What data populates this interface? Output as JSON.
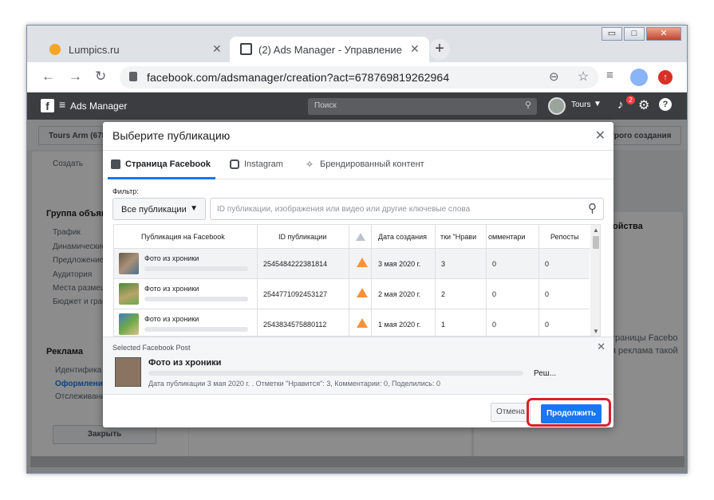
{
  "browser": {
    "tabs": [
      {
        "title": "Lumpics.ru",
        "close": "✕"
      },
      {
        "title": "(2) Ads Manager - Управление р",
        "close": "✕"
      }
    ],
    "new_tab": "+",
    "url": "facebook.com/adsmanager/creation?act=678769819262964",
    "window_buttons": [
      "▭",
      "□",
      "✕"
    ]
  },
  "fb": {
    "app_name": "Ads Manager",
    "search_placeholder": "Поиск",
    "account_name": "Tours",
    "notification_count": "2",
    "page_behind": {
      "account_button": "Tours Arm (678",
      "quick_create": "трого создания",
      "create_label": "Создать",
      "adset_title": "Группа объявл",
      "adset_items": [
        "Трафик",
        "Динамические",
        "Предложение",
        "Аудитория",
        "Места размещ",
        "Бюджет и граф"
      ],
      "ads_title": "Реклама",
      "ads_items": [
        "Идентифика",
        "Оформление",
        "Отслеживани"
      ],
      "close_button": "Закрыть",
      "preview_title": "ойства",
      "preview_text_1": "траницы Facebo",
      "preview_text_2": "я реклама такой"
    }
  },
  "dialog": {
    "title": "Выберите публикацию",
    "tabs": [
      "Страница Facebook",
      "Instagram",
      "Брендированный контент"
    ],
    "filter_label": "Фильтр:",
    "filter_value": "Все публикации",
    "search_placeholder": "ID публикации, изображения или видео или другие ключевые слова",
    "columns": [
      "Публикация на Facebook",
      "ID публикации",
      "",
      "Дата создания",
      "тки \"Нрави",
      "омментари",
      "Репосты"
    ],
    "rows": [
      {
        "post": "Фото из хроники",
        "id": "2545484222381814",
        "date": "3 мая 2020 г.",
        "likes": "3",
        "comments": "0",
        "shares": "0"
      },
      {
        "post": "Фото из хроники",
        "id": "2544771092453127",
        "date": "2 мая 2020 г.",
        "likes": "2",
        "comments": "0",
        "shares": "0"
      },
      {
        "post": "Фото из хроники",
        "id": "2543834575880112",
        "date": "1 мая 2020 г.",
        "likes": "1",
        "comments": "0",
        "shares": "0"
      }
    ],
    "selected": {
      "header": "Selected Facebook Post",
      "name": "Фото из хроники",
      "meta": "Дата публикации 3 мая 2020 г. . Отметки \"Нравится\": 3, Комментарии: 0, Поделились: 0",
      "more": "Реш..."
    },
    "cancel": "Отмена",
    "continue": "Продолжить"
  },
  "colors": {
    "accent": "#1877f2",
    "highlight": "#d6222a",
    "warning": "#f7923b"
  }
}
